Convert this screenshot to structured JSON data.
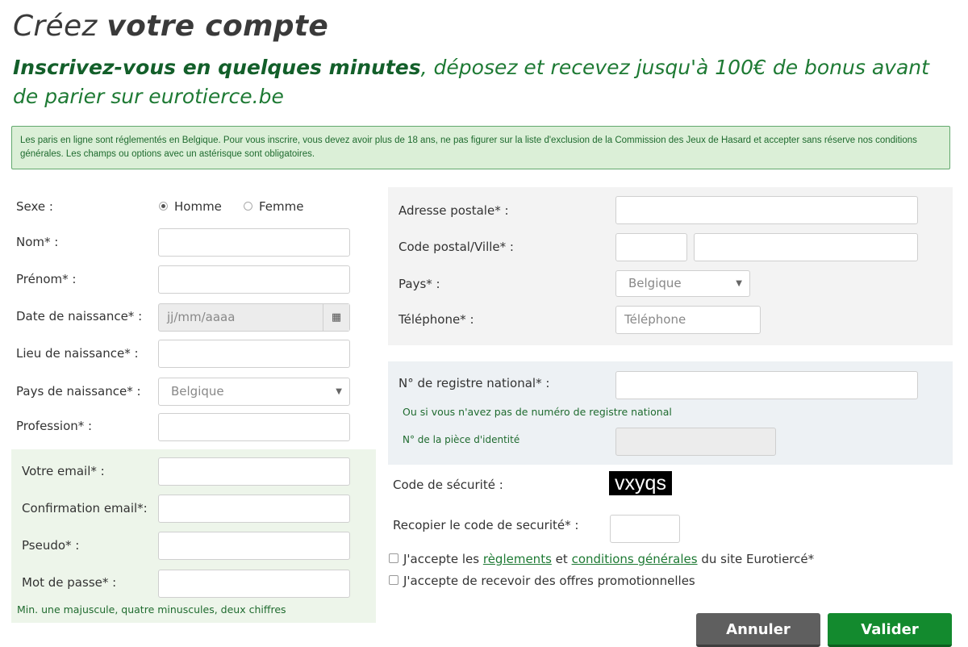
{
  "header": {
    "title_light": "Créez",
    "title_bold": "votre compte",
    "subtitle_bold": "Inscrivez-vous en quelques minutes",
    "subtitle_rest": ", déposez et recevez jusqu'à 100€ de bonus avant de parier sur eurotierce.be"
  },
  "notice": {
    "text": "Les paris en ligne sont réglementés en Belgique. Pour vous inscrire, vous devez avoir plus de 18 ans, ne pas figurer sur la liste d'exclusion de la Commission des Jeux de Hasard et accepter sans réserve nos conditions générales. Les champs ou options avec un astérisque sont obligatoires."
  },
  "left": {
    "sexe_label": "Sexe :",
    "homme_label": "Homme",
    "femme_label": "Femme",
    "homme_checked": true,
    "nom_label": "Nom* :",
    "prenom_label": "Prénom* :",
    "date_label": "Date de naissance* :",
    "date_placeholder": "jj/mm/aaaa",
    "lieu_label": "Lieu de naissance* :",
    "pays_naissance_label": "Pays de naissance* :",
    "pays_naissance_value": "Belgique",
    "profession_label": "Profession* :",
    "email_label": "Votre email* :",
    "email_confirm_label": "Confirmation email*:",
    "pseudo_label": "Pseudo* :",
    "password_label": "Mot de passe* :",
    "password_hint": "Min. une majuscule, quatre minuscules, deux chiffres"
  },
  "right": {
    "adresse_label": "Adresse postale* :",
    "code_postal_label": "Code postal/Ville* :",
    "pays_label": "Pays* :",
    "pays_value": "Belgique",
    "telephone_label": "Téléphone* :",
    "telephone_placeholder": "Téléphone",
    "registre_label": "N° de registre national* :",
    "registre_alt": "Ou si vous n'avez pas de numéro de registre national",
    "piece_label": "N° de la pièce d'identité",
    "security_label": "Code de sécurité :",
    "captcha_text": "vxyqs",
    "security_copy_label": "Recopier le code de securité* :",
    "accept_prefix": "J'accepte les",
    "accept_link1": "règlements",
    "accept_mid": "et",
    "accept_link2": "conditions générales",
    "accept_suffix": "du site Eurotiercé*",
    "promo_label": "J'accepte de recevoir des offres promotionnelles"
  },
  "buttons": {
    "cancel": "Annuler",
    "submit": "Valider"
  }
}
